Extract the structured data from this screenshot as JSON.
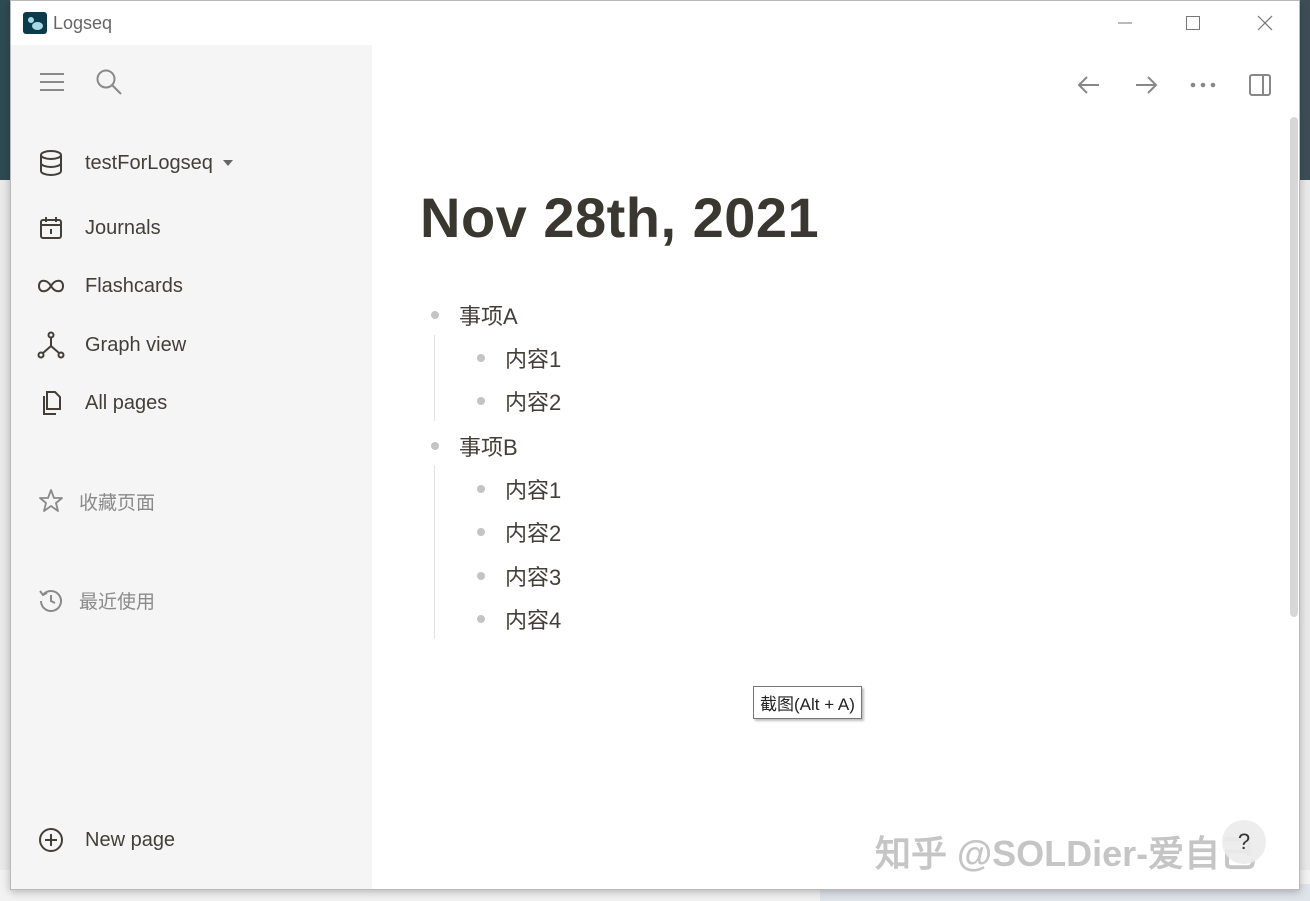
{
  "window": {
    "title": "Logseq",
    "controls": {
      "minimize": "minimize-icon",
      "maximize": "maximize-icon",
      "close": "close-icon"
    }
  },
  "sidebar": {
    "graph_name": "testForLogseq",
    "nav": [
      {
        "label": "Journals",
        "icon": "calendar-icon"
      },
      {
        "label": "Flashcards",
        "icon": "infinity-icon"
      },
      {
        "label": "Graph view",
        "icon": "graph-icon"
      },
      {
        "label": "All pages",
        "icon": "pages-icon"
      }
    ],
    "favorites_label": "收藏页面",
    "recent_label": "最近使用",
    "new_page_label": "New page"
  },
  "page": {
    "title": "Nov 28th, 2021",
    "blocks": [
      {
        "text": "事项A",
        "children": [
          "内容1",
          "内容2"
        ]
      },
      {
        "text": "事项B",
        "children": [
          "内容1",
          "内容2",
          "内容3",
          "内容4"
        ]
      }
    ]
  },
  "tooltip": {
    "text": "截图(Alt + A)"
  },
  "watermark": "知乎 @SOLDier-爱自己",
  "help": {
    "label": "?"
  }
}
